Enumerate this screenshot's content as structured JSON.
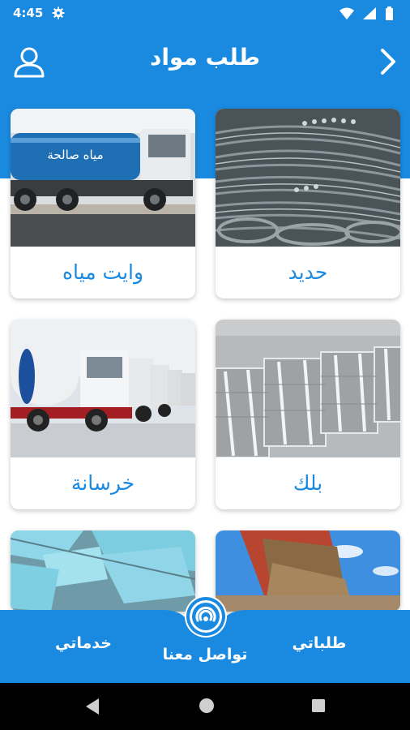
{
  "status_bar": {
    "time": "4:45"
  },
  "header": {
    "title": "طلب مواد"
  },
  "cards": [
    {
      "label": "حديد"
    },
    {
      "label": "وايت مياه",
      "truck_text": "مياه صالحة"
    },
    {
      "label": "بلك"
    },
    {
      "label": "خرسانة"
    },
    {
      "label": ""
    },
    {
      "label": ""
    }
  ],
  "bottom_nav": {
    "requests": "طلباتي",
    "contact": "تواصل معنا",
    "services": "خدماتي"
  },
  "colors": {
    "primary": "#1a8ae0",
    "label": "#1a8ae0"
  },
  "icons": {
    "profile": "user-icon",
    "back": "chevron-right-icon",
    "contact": "signal-broadcast-icon"
  }
}
